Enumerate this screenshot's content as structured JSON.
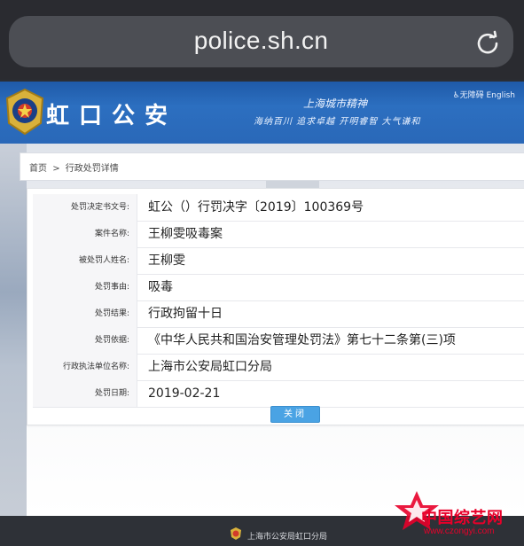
{
  "browser": {
    "url": "police.sh.cn",
    "reload_icon": "reload-icon"
  },
  "header": {
    "site_title": "虹口公安",
    "slogan_line1": "上海城市精神",
    "slogan_line2": "海纳百川 追求卓越 开明睿智 大气谦和",
    "accessibility_link": "♿无障碍 English",
    "brand_color": "#2a68b8"
  },
  "breadcrumb": {
    "home": "首页",
    "separator": ">",
    "current": "行政处罚详情"
  },
  "details": {
    "rows": [
      {
        "label": "处罚决定书文号:",
        "value": "虹公（）行罚决字〔2019〕100369号"
      },
      {
        "label": "案件名称:",
        "value": "王柳雯吸毒案"
      },
      {
        "label": "被处罚人姓名:",
        "value": "王柳雯"
      },
      {
        "label": "处罚事由:",
        "value": "吸毒"
      },
      {
        "label": "处罚结果:",
        "value": "行政拘留十日"
      },
      {
        "label": "处罚依据:",
        "value": "《中华人民共和国治安管理处罚法》第七十二条第(三)项"
      },
      {
        "label": "行政执法单位名称:",
        "value": "上海市公安局虹口分局"
      },
      {
        "label": "处罚日期:",
        "value": "2019-02-21"
      }
    ],
    "close_label": "关闭",
    "button_color": "#4aa3e4"
  },
  "footer": {
    "text": "上海市公安局虹口分局"
  },
  "watermark": {
    "name": "中国综艺网",
    "url": "www.czongyi.com",
    "color": "#e8002a"
  }
}
